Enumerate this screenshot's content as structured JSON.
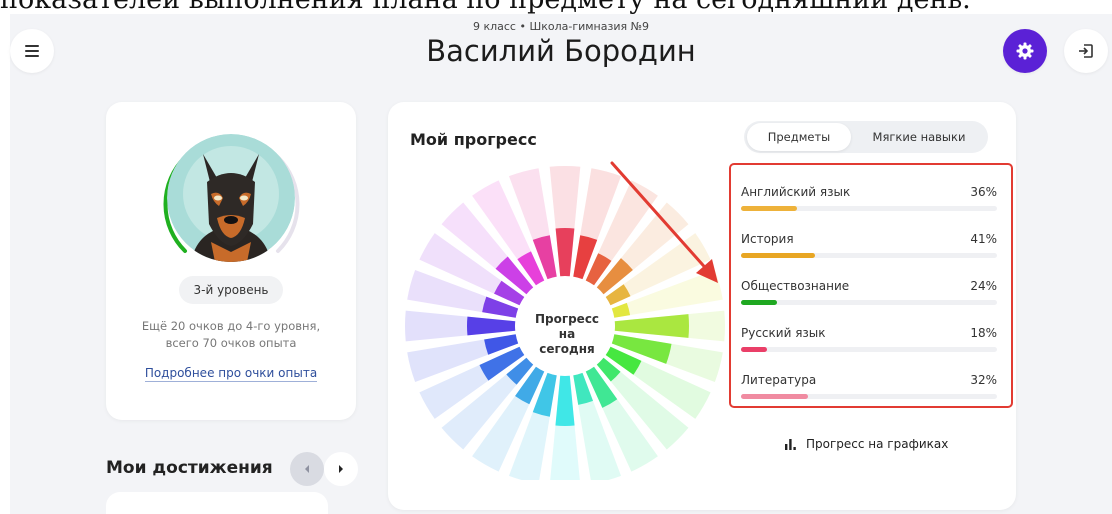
{
  "caption": "показателей выполнения плана по предмету на сегодняшний день.",
  "header": {
    "subtitle": "9 класс • Школа-гимназия №9",
    "name": "Василий Бородин"
  },
  "icons": {
    "menu": "menu-icon",
    "settings": "gear-icon",
    "logout": "logout-icon",
    "charts": "bar-chart-icon"
  },
  "colors": {
    "accent": "#5b21d6",
    "highlight": "#e23b32",
    "level_ring": "#1fb01f"
  },
  "profile": {
    "level_badge": "3-й уровень",
    "level_hint_line1": "Ещё 20 очков до 4-го уровня,",
    "level_hint_line2": "всего 70 очков опыта",
    "xp_link": "Подробнее про очки опыта",
    "level_progress": 0.57
  },
  "achievements": {
    "title": "Мои достижения"
  },
  "progress": {
    "title": "Мой прогресс",
    "tabs": [
      {
        "label": "Предметы",
        "active": true
      },
      {
        "label": "Мягкие навыки",
        "active": false
      }
    ],
    "center_line1": "Прогресс",
    "center_line2": "на сегодня",
    "subjects": [
      {
        "name": "Английский язык",
        "percent": "36%",
        "value": 0.22,
        "color": "#eeb23a"
      },
      {
        "name": "История",
        "percent": "41%",
        "value": 0.29,
        "color": "#e8a623"
      },
      {
        "name": "Обществознание",
        "percent": "24%",
        "value": 0.14,
        "color": "#1fa821"
      },
      {
        "name": "Русский язык",
        "percent": "18%",
        "value": 0.1,
        "color": "#ea3f68"
      },
      {
        "name": "Литература",
        "percent": "32%",
        "value": 0.26,
        "color": "#f08ba1"
      }
    ],
    "charts_link": "Прогресс на графиках"
  }
}
